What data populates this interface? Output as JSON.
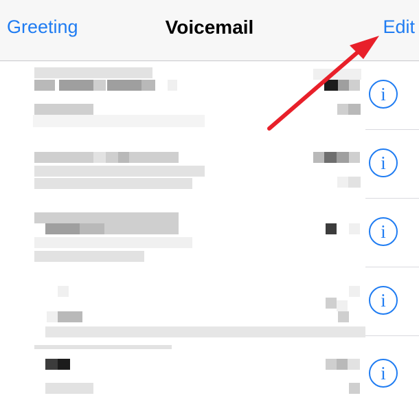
{
  "navbar": {
    "left_label": "Greeting",
    "title": "Voicemail",
    "right_label": "Edit"
  },
  "list": {
    "info_glyph": "i",
    "row_count": 5
  },
  "annotation": {
    "type": "arrow",
    "color": "#e8202a",
    "points_to": "Edit"
  },
  "colors": {
    "accent": "#1f7cf2",
    "navbar_bg": "#f7f7f7",
    "separator": "#c8c7cc"
  }
}
